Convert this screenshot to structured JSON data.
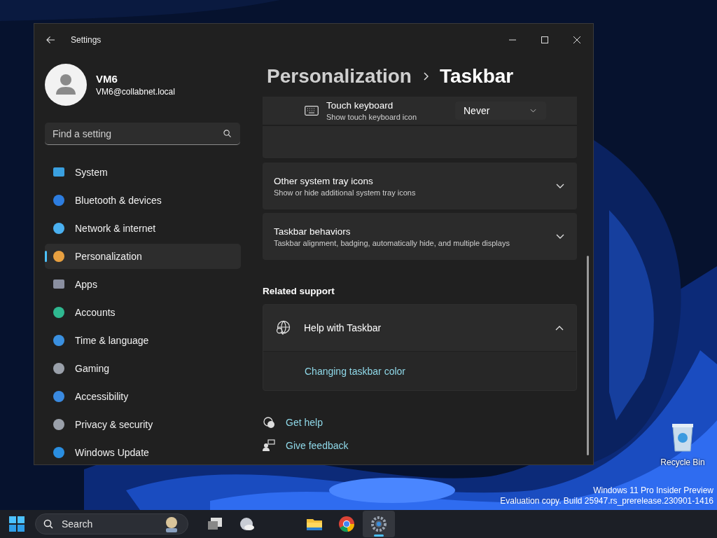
{
  "window": {
    "title": "Settings"
  },
  "user": {
    "name": "VM6",
    "email": "VM6@collabnet.local"
  },
  "search": {
    "placeholder": "Find a setting"
  },
  "nav": [
    {
      "label": "System",
      "selected": false
    },
    {
      "label": "Bluetooth & devices",
      "selected": false
    },
    {
      "label": "Network & internet",
      "selected": false
    },
    {
      "label": "Personalization",
      "selected": true
    },
    {
      "label": "Apps",
      "selected": false
    },
    {
      "label": "Accounts",
      "selected": false
    },
    {
      "label": "Time & language",
      "selected": false
    },
    {
      "label": "Gaming",
      "selected": false
    },
    {
      "label": "Accessibility",
      "selected": false
    },
    {
      "label": "Privacy & security",
      "selected": false
    },
    {
      "label": "Windows Update",
      "selected": false
    }
  ],
  "breadcrumb": [
    "Personalization",
    "Taskbar"
  ],
  "touch_keyboard": {
    "title": "Touch keyboard",
    "subtitle": "Show touch keyboard icon",
    "value": "Never"
  },
  "cards": [
    {
      "title": "Other system tray icons",
      "subtitle": "Show or hide additional system tray icons",
      "expanded": false
    },
    {
      "title": "Taskbar behaviors",
      "subtitle": "Taskbar alignment, badging, automatically hide, and multiple displays",
      "expanded": false
    }
  ],
  "related_support": {
    "heading": "Related support",
    "title": "Help with Taskbar",
    "expanded": true,
    "links": [
      "Changing taskbar color"
    ]
  },
  "footer_links": [
    "Get help",
    "Give feedback"
  ],
  "desktop": {
    "recycle_bin": "Recycle Bin",
    "watermark": [
      "Windows 11 Pro Insider Preview",
      "Evaluation copy. Build 25947.rs_prerelease.230901-1416"
    ]
  },
  "taskbar": {
    "search_placeholder": "Search",
    "apps": [
      {
        "selected": false
      },
      {
        "selected": false
      },
      {
        "selected": false
      },
      {
        "selected": false
      },
      {
        "selected": true
      }
    ]
  }
}
